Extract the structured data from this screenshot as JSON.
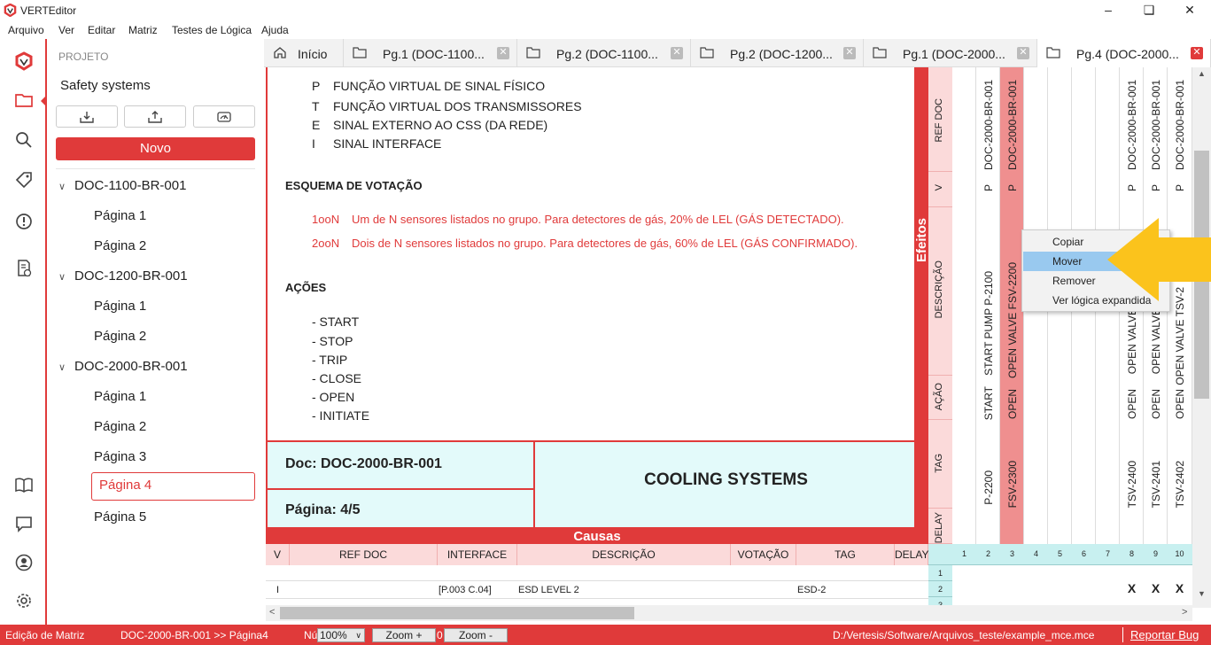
{
  "app": {
    "title": "VERTEditor"
  },
  "menu": [
    "Arquivo",
    "Ver",
    "Editar",
    "Matriz",
    "Testes de Lógica",
    "Ajuda"
  ],
  "project": {
    "label": "PROJETO",
    "name": "Safety systems",
    "new_button": "Novo",
    "docs": [
      {
        "name": "DOC-1100-BR-001",
        "pages": [
          "Página 1",
          "Página 2"
        ]
      },
      {
        "name": "DOC-1200-BR-001",
        "pages": [
          "Página 1",
          "Página 2"
        ]
      },
      {
        "name": "DOC-2000-BR-001",
        "pages": [
          "Página 1",
          "Página 2",
          "Página 3",
          "Página 4",
          "Página 5"
        ]
      }
    ]
  },
  "tabs": [
    {
      "label": "Início"
    },
    {
      "label": "Pg.1 (DOC-1100..."
    },
    {
      "label": "Pg.2 (DOC-1100..."
    },
    {
      "label": "Pg.2 (DOC-1200..."
    },
    {
      "label": "Pg.1 (DOC-2000..."
    },
    {
      "label": "Pg.4 (DOC-2000..."
    }
  ],
  "legend": [
    {
      "k": "P",
      "v": "FUNÇÃO VIRTUAL DE SINAL FÍSICO"
    },
    {
      "k": "T",
      "v": "FUNÇÃO VIRTUAL DOS TRANSMISSORES"
    },
    {
      "k": "E",
      "v": "SINAL EXTERNO AO CSS (DA REDE)"
    },
    {
      "k": "I",
      "v": "SINAL INTERFACE"
    }
  ],
  "voting": {
    "title": "ESQUEMA DE VOTAÇÃO",
    "items": [
      {
        "k": "1ooN",
        "v": "Um de N sensores listados no grupo. Para detectores de gás, 20% de LEL (GÁS DETECTADO)."
      },
      {
        "k": "2ooN",
        "v": "Dois de N sensores listados no grupo. Para detectores de gás, 60% de LEL (GÁS CONFIRMADO)."
      }
    ]
  },
  "actions": {
    "title": "AÇÕES",
    "items": [
      "- START",
      "- STOP",
      "- TRIP",
      "- CLOSE",
      "- OPEN",
      "- INITIATE"
    ]
  },
  "info": {
    "doc": "Doc: DOC-2000-BR-001",
    "page": "Página: 4/5",
    "title": "COOLING SYSTEMS"
  },
  "causas": {
    "header": "Causas",
    "columns": [
      "V",
      "REF DOC",
      "INTERFACE",
      "DESCRIÇÃO",
      "VOTAÇÃO",
      "TAG",
      "DELAY"
    ],
    "row": {
      "v": "I",
      "ref": "",
      "interface": "[P.003 C.04]",
      "desc": "ESD LEVEL 2",
      "vot": "",
      "tag": "ESD-2",
      "delay": ""
    }
  },
  "efeitos": {
    "header": "Efeitos",
    "row_labels": [
      "REF DOC",
      "V",
      "DESCRIÇÃO",
      "AÇÃO",
      "TAG",
      "DELAY"
    ],
    "columns": [
      {
        "n": "1",
        "ref": "",
        "v": "",
        "desc": "",
        "acao": "",
        "tag": ""
      },
      {
        "n": "2",
        "ref": "DOC-2000-BR-001",
        "v": "P",
        "desc": "START PUMP P-2100",
        "acao": "START",
        "tag": "P-2200"
      },
      {
        "n": "3",
        "ref": "DOC-2000-BR-001",
        "v": "P",
        "desc": "OPEN VALVE FSV-2200",
        "acao": "OPEN",
        "tag": "FSV-2300"
      },
      {
        "n": "4",
        "ref": "",
        "v": "",
        "desc": "",
        "acao": "",
        "tag": ""
      },
      {
        "n": "5",
        "ref": "",
        "v": "",
        "desc": "",
        "acao": "",
        "tag": ""
      },
      {
        "n": "6",
        "ref": "",
        "v": "",
        "desc": "",
        "acao": "",
        "tag": ""
      },
      {
        "n": "7",
        "ref": "",
        "v": "",
        "desc": "",
        "acao": "",
        "tag": ""
      },
      {
        "n": "8",
        "ref": "DOC-2000-BR-001",
        "v": "P",
        "desc": "OPEN VALVE",
        "acao": "OPEN",
        "tag": "TSV-2400"
      },
      {
        "n": "9",
        "ref": "DOC-2000-BR-001",
        "v": "P",
        "desc": "OPEN VALVE",
        "acao": "OPEN",
        "tag": "TSV-2401"
      },
      {
        "n": "10",
        "ref": "DOC-2000-BR-001",
        "v": "P",
        "desc": "OPEN VALVE TSV-2",
        "acao": "OPEN",
        "tag": "TSV-2402"
      }
    ],
    "row_numbers": [
      "1",
      "2",
      "3"
    ],
    "x_mark": "X"
  },
  "context_menu": [
    "Copiar",
    "Mover",
    "Remover",
    "Ver lógica expandida"
  ],
  "status": {
    "mode": "Edição de Matriz",
    "breadcrumb": "DOC-2000-BR-001 >> Página4",
    "num_label": "Nú",
    "zoom": "100%",
    "zoom_in": "Zoom +",
    "zoom_hidden": "0",
    "zoom_out": "Zoom -",
    "path": "D:/Vertesis/Software/Arquivos_teste/example_mce.mce",
    "report": "Reportar Bug"
  },
  "colors": {
    "accent": "#e03a3a",
    "highlight_col": "#ef8f8f",
    "info_bg": "#e3fafa",
    "arrow": "#fbc31c"
  }
}
